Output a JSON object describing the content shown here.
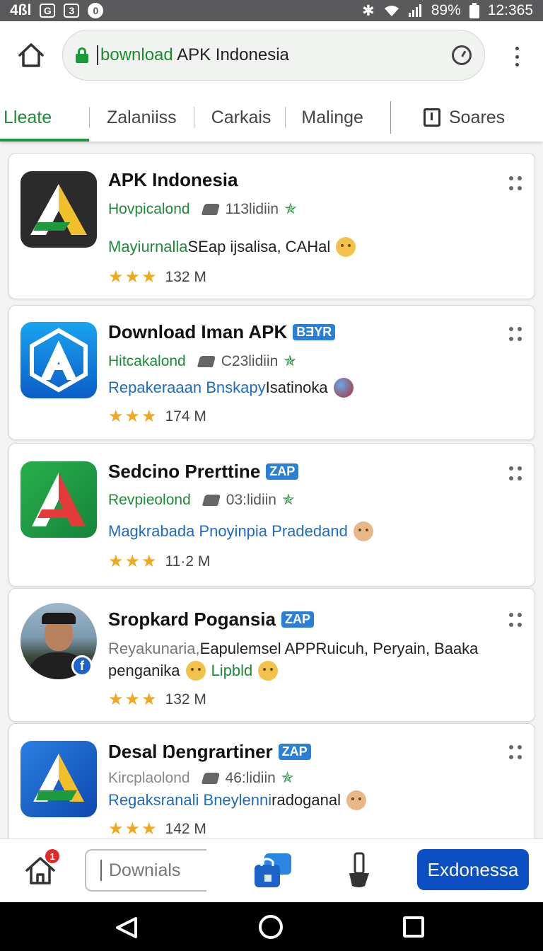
{
  "status": {
    "left_text": "4ßl",
    "box1": "G",
    "box2": "3",
    "circle": "0",
    "battery": "89%",
    "time": "12:365"
  },
  "browser": {
    "url_highlight": "bownload",
    "url_rest": " APK Indonesia",
    "tabs": [
      "Lleate",
      "Zalaniiss",
      "Carkais",
      "Malinge"
    ],
    "share_label": "Soares"
  },
  "apps": [
    {
      "title": "APK Indonesia",
      "badge": "",
      "meta_green": "Hovpicalond",
      "meta_gray": "113lidiin",
      "desc_green": "Mayiurnalla",
      "desc_rest": " SEap ijsalisa, CAHal",
      "rating": "132 M"
    },
    {
      "title": "Download Iman APK",
      "badge": "BƎYR",
      "meta_green": "Hitcakalond",
      "meta_gray": "C23lidiin",
      "desc_blue": "Repakeraaan Bnskapy",
      "desc_rest": " Isatinoka",
      "rating": "174 M"
    },
    {
      "title": "Sedcino Prerttine",
      "badge": "ZAP",
      "meta_green": "Revpieolond",
      "meta_gray": "03:lidiin",
      "desc_blue": "Magkrabada Pnoyinpia Pradedand",
      "rating": "11·2 M"
    },
    {
      "title": "Sropkard Pogansia",
      "badge": "ZAP",
      "desc_gray": "Reyakunaria,",
      "desc_rest": " Eapulemsel APPRuicuh, Peryain, Baaka",
      "desc2_start": "penganika",
      "desc2_green": "Lipbld",
      "rating": "132 M"
    },
    {
      "title": "Desal Ŋengrartiner",
      "badge": "ZAP",
      "meta_gray_lead": "Kircplaolond",
      "meta_gray": "46:lidiin",
      "desc_blue": "Regaksranali Bneylenni",
      "desc_rest": "radoganal",
      "rating": "142 M"
    }
  ],
  "bottom": {
    "notif_count": "1",
    "downloads_text": "Downials",
    "cta_label": "Exdonessa"
  },
  "colors": {
    "accent_green": "#1e9a3e",
    "cta_blue": "#0b4fc2",
    "star": "#f0a91e"
  },
  "icons": [
    "home-icon",
    "lock-icon",
    "timer-icon",
    "more-vert-icon",
    "share-icon",
    "bag-icon",
    "brush-icon",
    "back-icon"
  ]
}
